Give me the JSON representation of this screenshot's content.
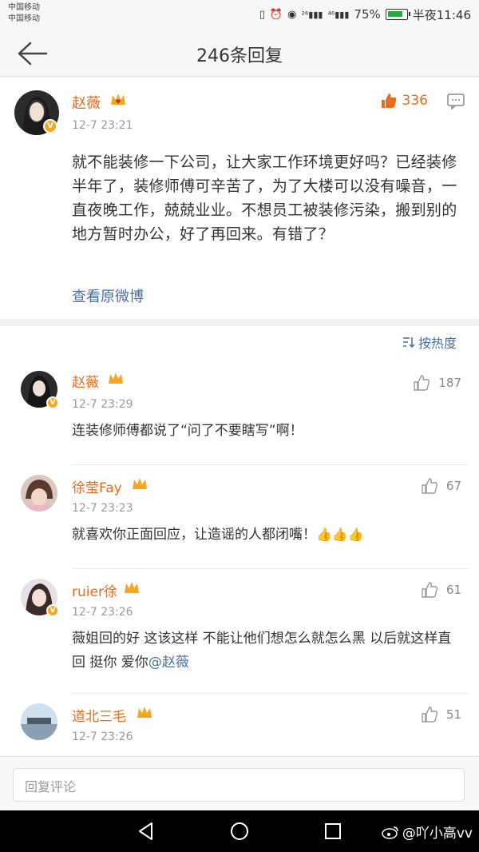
{
  "status": {
    "carrier1": "中国移动",
    "carrier2": "中国移动",
    "battery": "75%",
    "time": "半夜11:46"
  },
  "nav": {
    "title": "246条回复"
  },
  "post": {
    "author": "赵薇",
    "time": "12-7 23:21",
    "likes": "336",
    "text": "就不能装修一下公司，让大家工作环境更好吗？已经装修半年了，装修师傅可辛苦了，为了大楼可以没有噪音，一直夜晚工作，兢兢业业。不想员工被装修污染，搬到别的地方暂时办公，好了再回来。有错了？",
    "view_original": "查看原微博"
  },
  "sort": {
    "label": "按热度"
  },
  "comments": [
    {
      "author": "赵薇",
      "time": "12-7 23:29",
      "likes": "187",
      "text": "连装修师傅都说了“问了不要瞎写”啊！"
    },
    {
      "author": "徐莹Fay",
      "time": "12-7 23:23",
      "likes": "67",
      "text": "就喜欢你正面回应，让造谣的人都闭嘴！",
      "emoji": "👍👍👍"
    },
    {
      "author": "ruier徐",
      "time": "12-7 23:26",
      "likes": "61",
      "text": "薇姐回的好 这该这样 不能让他们想怎么就怎么黑 以后就这样直回 挺你 爱你",
      "mention": "@赵薇"
    },
    {
      "author": "道北三毛",
      "time": "12-7 23:26",
      "likes": "51",
      "text": ""
    }
  ],
  "reply": {
    "placeholder": "回复评论"
  },
  "watermark": "@吖小高vv",
  "colors": {
    "name": "#e86b1f",
    "link": "#4a6fa5",
    "gray": "#999999"
  }
}
